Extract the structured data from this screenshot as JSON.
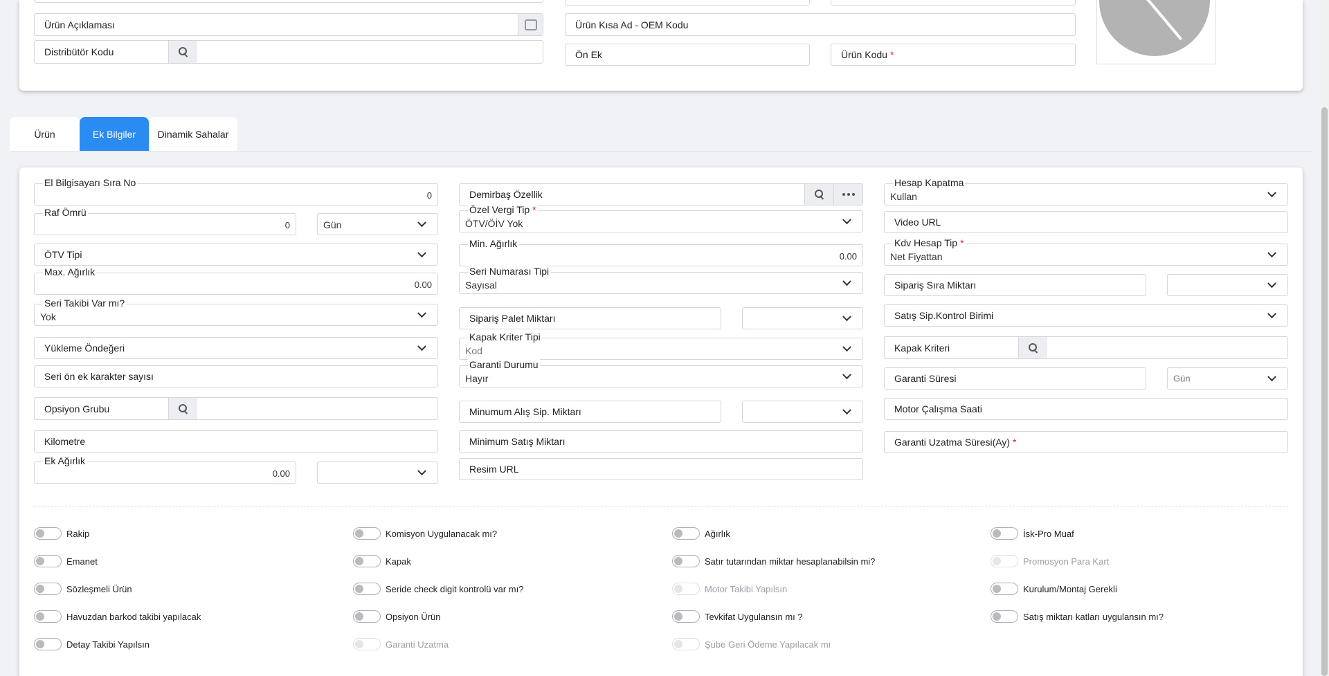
{
  "top": {
    "urun_aciklamasi": "Ürün Açıklaması",
    "distributor_kodu": "Distribütör Kodu",
    "kisa_ad": "Ürün Kısa Ad - OEM Kodu",
    "on_ek": "Ön Ek",
    "urun_kodu": "Ürün Kodu",
    "req": "*"
  },
  "tabs": [
    "Ürün",
    "Ek Bilgiler",
    "Dinamik Sahalar"
  ],
  "col1": {
    "el_bilgisayari": {
      "label": "El Bilgisayarı Sıra No",
      "value": "0"
    },
    "raf_omru": {
      "label": "Raf Ömrü",
      "value": "0",
      "unit": "Gün"
    },
    "otv_tipi": "ÖTV Tipi",
    "max_agirlik": {
      "label": "Max. Ağırlık",
      "value": "0.00"
    },
    "seri_takibi": {
      "label": "Seri Takibi Var mı?",
      "value": "Yok"
    },
    "yukleme": "Yükleme Öndeğeri",
    "seri_on_ek": "Seri ön ek karakter sayısı",
    "opsiyon_grubu": "Opsiyon Grubu",
    "kilometre": "Kilometre",
    "ek_agirlik": {
      "label": "Ek Ağırlık",
      "value": "0.00"
    }
  },
  "col2": {
    "demirbas": "Demirbaş Özellik",
    "ozel_vergi": {
      "label": "Özel Vergi Tip",
      "value": "ÖTV/ÖİV Yok"
    },
    "min_agirlik": {
      "label": "Min. Ağırlık",
      "value": "0.00"
    },
    "seri_numarasi": {
      "label": "Seri Numarası Tipi",
      "value": "Sayısal"
    },
    "siparis_palet": "Sipariş Palet Miktarı",
    "kapak_kriter_tipi": {
      "label": "Kapak Kriter Tipi",
      "value": "Kod"
    },
    "garanti_durumu": {
      "label": "Garanti Durumu",
      "value": "Hayır"
    },
    "min_alis": "Minumum Alış Sip. Miktarı",
    "min_satis": "Minimum Satış Miktarı",
    "resim_url": "Resim URL"
  },
  "col3": {
    "hesap_kapatma": {
      "label": "Hesap Kapatma",
      "value": "Kullan"
    },
    "video_url": "Video URL",
    "kdv_hesap": {
      "label": "Kdv Hesap Tip",
      "value": "Net Fiyattan"
    },
    "siparis_sira": "Sipariş Sıra Miktarı",
    "satis_sip": "Satış Sip.Kontrol Birimi",
    "kapak_kriteri": "Kapak Kriteri",
    "garanti_suresi": {
      "label": "Garanti Süresi",
      "unit": "Gün"
    },
    "motor": "Motor Çalışma Saati",
    "garanti_uzatma": "Garanti Uzatma Süresi(Ay)"
  },
  "toggles": {
    "c1": [
      "Rakip",
      "Emanet",
      "Sözleşmeli Ürün",
      "Havuzdan barkod takibi yapılacak",
      "Detay Takibi Yapılsın"
    ],
    "c2": [
      "Komisyon Uygulanacak mı?",
      "Kapak",
      "Seride check digit kontrolü var mı?",
      "Opsiyon Ürün",
      "Garanti Uzatma"
    ],
    "c3": [
      "Ağırlık",
      "Satır tutarından miktar hesaplanabilsin mi?",
      "Motor Takibi Yapılsın",
      "Tevkifat Uygulansın mı ?",
      "Şube Geri Ödeme Yapılacak mı"
    ],
    "c4": [
      "İsk-Pro Muaf",
      "Promosyon Para Kart",
      "Kurulum/Montaj Gerekli",
      "Satış miktarı katları uygulansın mı?"
    ]
  }
}
